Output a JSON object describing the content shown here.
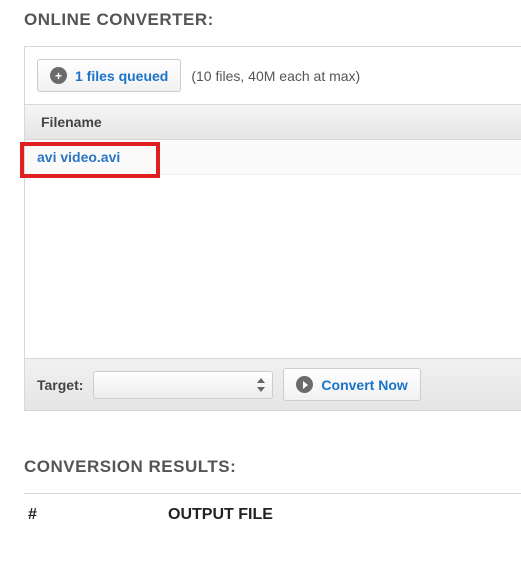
{
  "converter": {
    "title": "ONLINE CONVERTER:",
    "queue_button_label": "1 files queued",
    "queue_hint": "(10 files, 40M each at max)",
    "table": {
      "header": "Filename",
      "rows": [
        {
          "filename": "avi video.avi"
        }
      ]
    },
    "footer": {
      "target_label": "Target:",
      "target_value": "",
      "convert_label": "Convert Now"
    }
  },
  "results": {
    "title": "CONVERSION RESULTS:",
    "columns": {
      "num": "#",
      "output": "OUTPUT FILE"
    }
  }
}
